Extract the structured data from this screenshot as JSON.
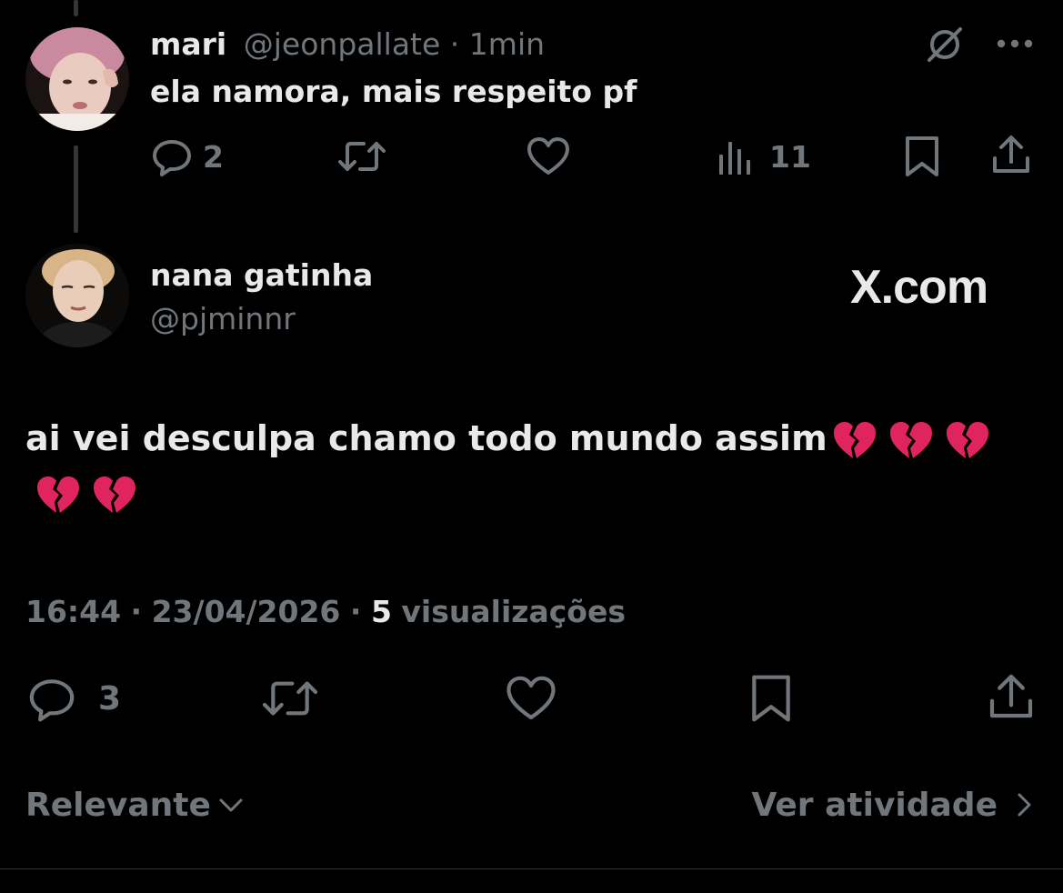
{
  "reply_tweet": {
    "author_name": "mari",
    "handle": "@jeonpallate",
    "separator": "·",
    "time": "1min",
    "text": "ela namora, mais respeito pf",
    "actions": {
      "reply_count": "2",
      "views_count": "11"
    }
  },
  "main_tweet": {
    "author_name": "nana gatinha",
    "handle": "@pjminnr",
    "watermark": "X.com",
    "text": "ai vei desculpa chamo todo mundo assim",
    "emoji_glyph": "💔",
    "emoji_count": 5,
    "meta": {
      "time": "16:44",
      "separator": "·",
      "date": "23/04/2026",
      "separator2": "·",
      "views_count": "5",
      "views_label": "visualizações"
    },
    "actions": {
      "reply_count": "3"
    }
  },
  "footer": {
    "sort_label": "Relevante",
    "activity_label": "Ver atividade"
  },
  "icons": [
    "mute-icon",
    "more-icon",
    "reply-icon",
    "retweet-icon",
    "like-icon",
    "views-icon",
    "bookmark-icon",
    "share-icon",
    "chevron-down-icon",
    "chevron-right-icon",
    "broken-heart-icon"
  ],
  "colors": {
    "background": "#000000",
    "text": "#e7e9ea",
    "muted": "#71767b",
    "broken_heart": "#e0245e"
  }
}
